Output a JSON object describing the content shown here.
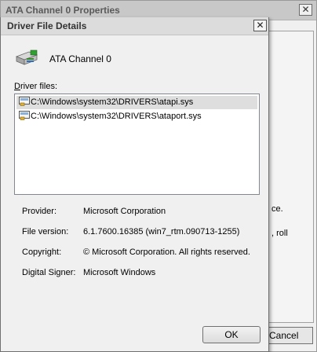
{
  "background_window": {
    "title": "ATA Channel 0 Properties",
    "close_glyph": "✕",
    "partial_text_1": "ce.",
    "partial_text_2": ", roll",
    "cancel_partial": "Cancel"
  },
  "dialog": {
    "title": "Driver File Details",
    "close_glyph": "✕",
    "device_name": "ATA Channel 0",
    "device_icon": "ide-controller-icon",
    "driver_files_label_hotkey": "D",
    "driver_files_label_rest": "river files:",
    "files": [
      {
        "path": "C:\\Windows\\system32\\DRIVERS\\atapi.sys",
        "selected": true,
        "icon": "signed-driver-file-icon"
      },
      {
        "path": "C:\\Windows\\system32\\DRIVERS\\ataport.sys",
        "selected": false,
        "icon": "signed-driver-file-icon"
      }
    ],
    "details": [
      {
        "label": "Provider:",
        "value": "Microsoft Corporation"
      },
      {
        "label": "File version:",
        "value": "6.1.7600.16385 (win7_rtm.090713-1255)"
      },
      {
        "label": "Copyright:",
        "value": "© Microsoft Corporation. All rights reserved."
      },
      {
        "label": "Digital Signer:",
        "value": "Microsoft Windows"
      }
    ],
    "ok_label": "OK"
  }
}
